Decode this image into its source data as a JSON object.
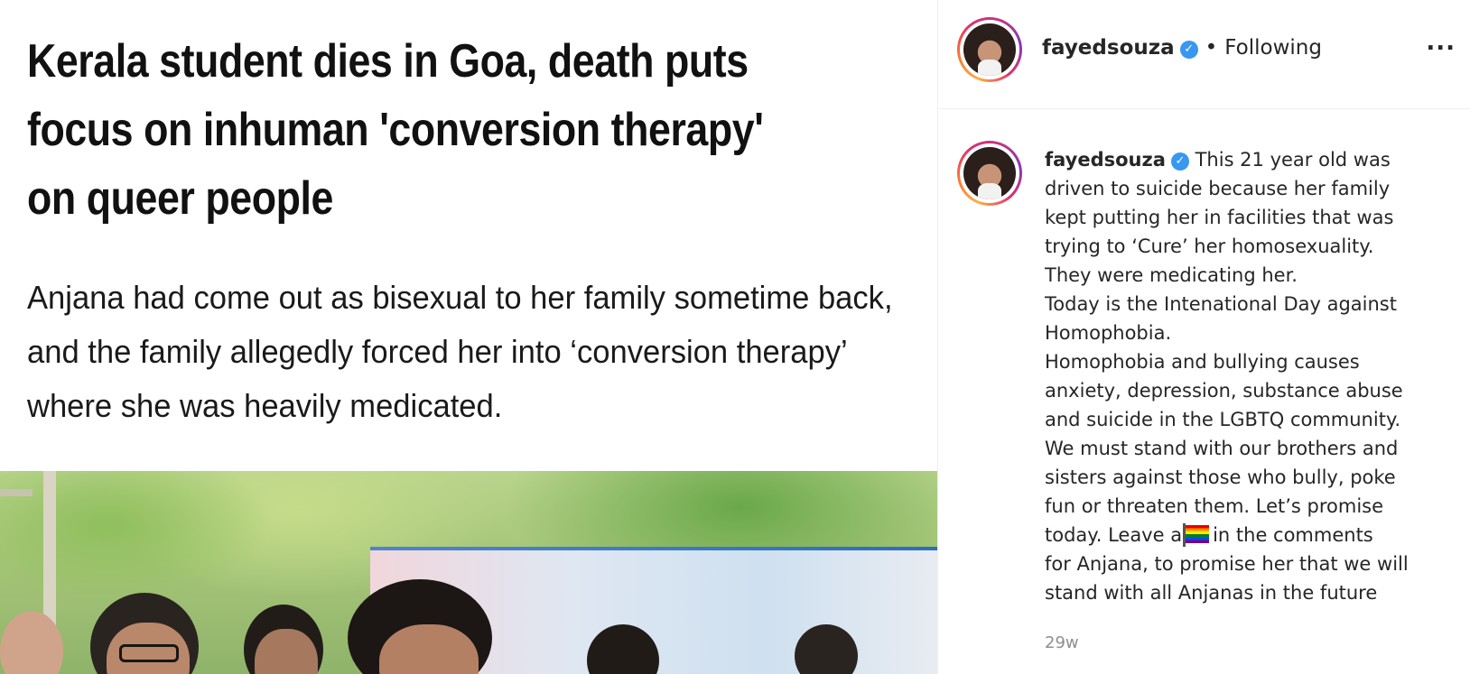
{
  "article": {
    "headline": "Kerala student dies in Goa, death puts focus on inhuman 'conversion therapy' on queer people",
    "summary": "Anjana had come out as bisexual to her family sometime back, and the family allegedly forced her into ‘conversion therapy’ where she was heavily medicated."
  },
  "header": {
    "username": "fayedsouza",
    "verified_icon": "verified-badge-icon",
    "separator": "•",
    "follow_status": "Following",
    "more_label": "..."
  },
  "caption": {
    "username": "fayedsouza",
    "lines": [
      "This 21 year old was",
      "driven to suicide because her family",
      "kept putting her in facilities that was",
      "trying to ‘Cure’ her homosexuality.",
      "They were medicating her.",
      "Today is the Intenational Day against",
      "Homophobia.",
      "Homophobia and bullying causes",
      "anxiety, depression, substance abuse",
      "and suicide in the LGBTQ community.",
      "We must stand with our brothers and",
      "sisters against those who bully, poke",
      "fun or threaten them. Let’s promise"
    ],
    "flag_line_before": "today. Leave a",
    "flag_line_after": "in the comments",
    "flag_icon": "rainbow-flag-icon",
    "closing_lines": [
      "for Anjana, to promise her that we will",
      "stand with all Anjanas in the future"
    ],
    "timestamp": "29w"
  },
  "colors": {
    "verified": "#3897f0",
    "text": "#262626",
    "muted": "#8e8e8e",
    "divider": "#efefef"
  }
}
